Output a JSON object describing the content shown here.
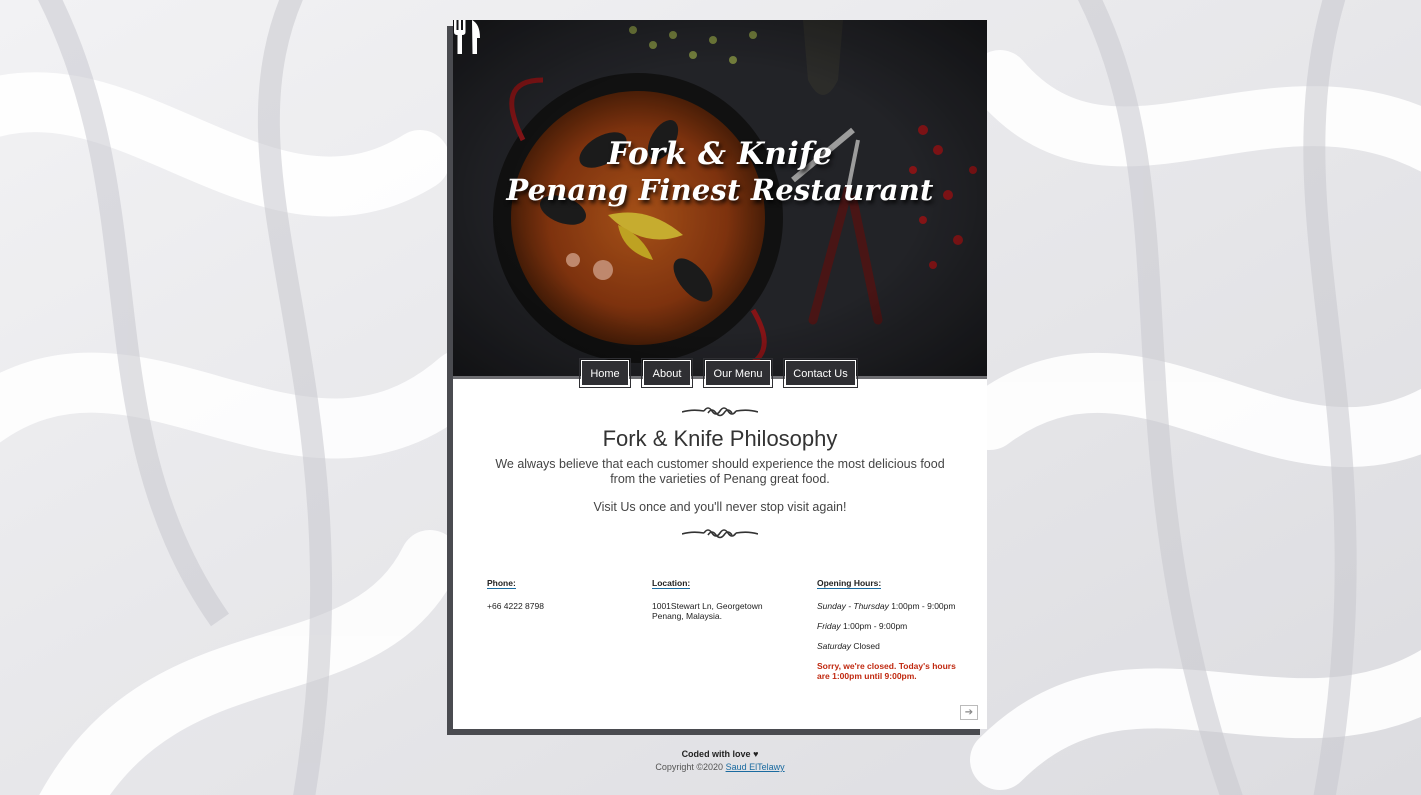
{
  "hero": {
    "title_line1": "Fork & Knife",
    "title_line2": "Penang Finest Restaurant",
    "icon": "utensils-icon"
  },
  "nav": {
    "items": [
      {
        "label": "Home"
      },
      {
        "label": "About"
      },
      {
        "label": "Our Menu"
      },
      {
        "label": "Contact Us"
      }
    ]
  },
  "philosophy": {
    "title": "Fork & Knife Philosophy",
    "text": "We always believe that each customer should experience the most delicious food from the varieties of Penang great food.",
    "visit": "Visit Us once and you'll never stop visit again!"
  },
  "info": {
    "phone_heading": "Phone:",
    "phone": "+66 4222 8798",
    "location_heading": "Location:",
    "location": "1001Stewart Ln, Georgetown Penang, Malaysia.",
    "hours_heading": "Opening Hours:",
    "hours": [
      {
        "day": "Sunday - Thursday",
        "time": "1:00pm - 9:00pm"
      },
      {
        "day": "Friday",
        "time": "1:00pm - 9:00pm"
      },
      {
        "day": "Saturday",
        "time": "Closed"
      }
    ],
    "status": "Sorry, we're closed. Today's hours are 1:00pm until 9:00pm."
  },
  "footer": {
    "coded": "Coded with love ♥",
    "copyright": "Copyright ©2020",
    "author": "Saud ElTelawy"
  },
  "colors": {
    "accent": "#1a6ba0",
    "closed": "#c0280f",
    "nav_bg": "#2f2f33"
  }
}
